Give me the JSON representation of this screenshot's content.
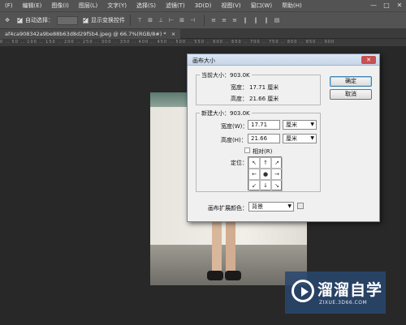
{
  "menubar": {
    "items": [
      "(F)",
      "编辑(E)",
      "图像(I)",
      "图层(L)",
      "文字(Y)",
      "选择(S)",
      "滤镜(T)",
      "3D(D)",
      "视图(V)",
      "窗口(W)",
      "帮助(H)"
    ],
    "window_controls": [
      "—",
      "□",
      "✕"
    ]
  },
  "options": {
    "auto_select_label": "自动选择：",
    "show_transform_label": "显示变换控件",
    "auto_select_checked": true,
    "show_transform_checked": true
  },
  "document": {
    "tab_title": "af4ca908342a9be88b63d8d29f5b4.jpeg @ 66.7%(RGB/8#) *",
    "tab_close": "×",
    "ruler": "0 .. 50 .. 100 .. 150 .. 200 .. 250 .. 300 .. 350 .. 400 .. 450 .. 500 .. 550 .. 600 .. 650 .. 700 .. 750 .. 800 .. 850 .. 900"
  },
  "dialog": {
    "title": "画布大小",
    "close": "✕",
    "current_size_label": "当前大小：903.0K",
    "current_width_label": "宽度：",
    "current_width_value": "17.71 厘米",
    "current_height_label": "高度：",
    "current_height_value": "21.66 厘米",
    "new_size_label": "新建大小：903.0K",
    "width_label": "宽度(W)：",
    "width_value": "17.71",
    "width_unit": "厘米",
    "height_label": "高度(H)：",
    "height_value": "21.66",
    "height_unit": "厘米",
    "relative_label": "相对(R)",
    "relative_checked": false,
    "anchor_label": "定位：",
    "anchor_cells": [
      "↖",
      "↑",
      "↗",
      "←",
      "●",
      "→",
      "↙",
      "↓",
      "↘"
    ],
    "extension_color_label": "画布扩展颜色：",
    "extension_color_value": "背景",
    "ok_label": "确定",
    "cancel_label": "取消",
    "dropdown_arrow": "▼"
  },
  "watermark": {
    "name": "溜溜自学",
    "url": "ZIXUE.3D66.COM"
  }
}
